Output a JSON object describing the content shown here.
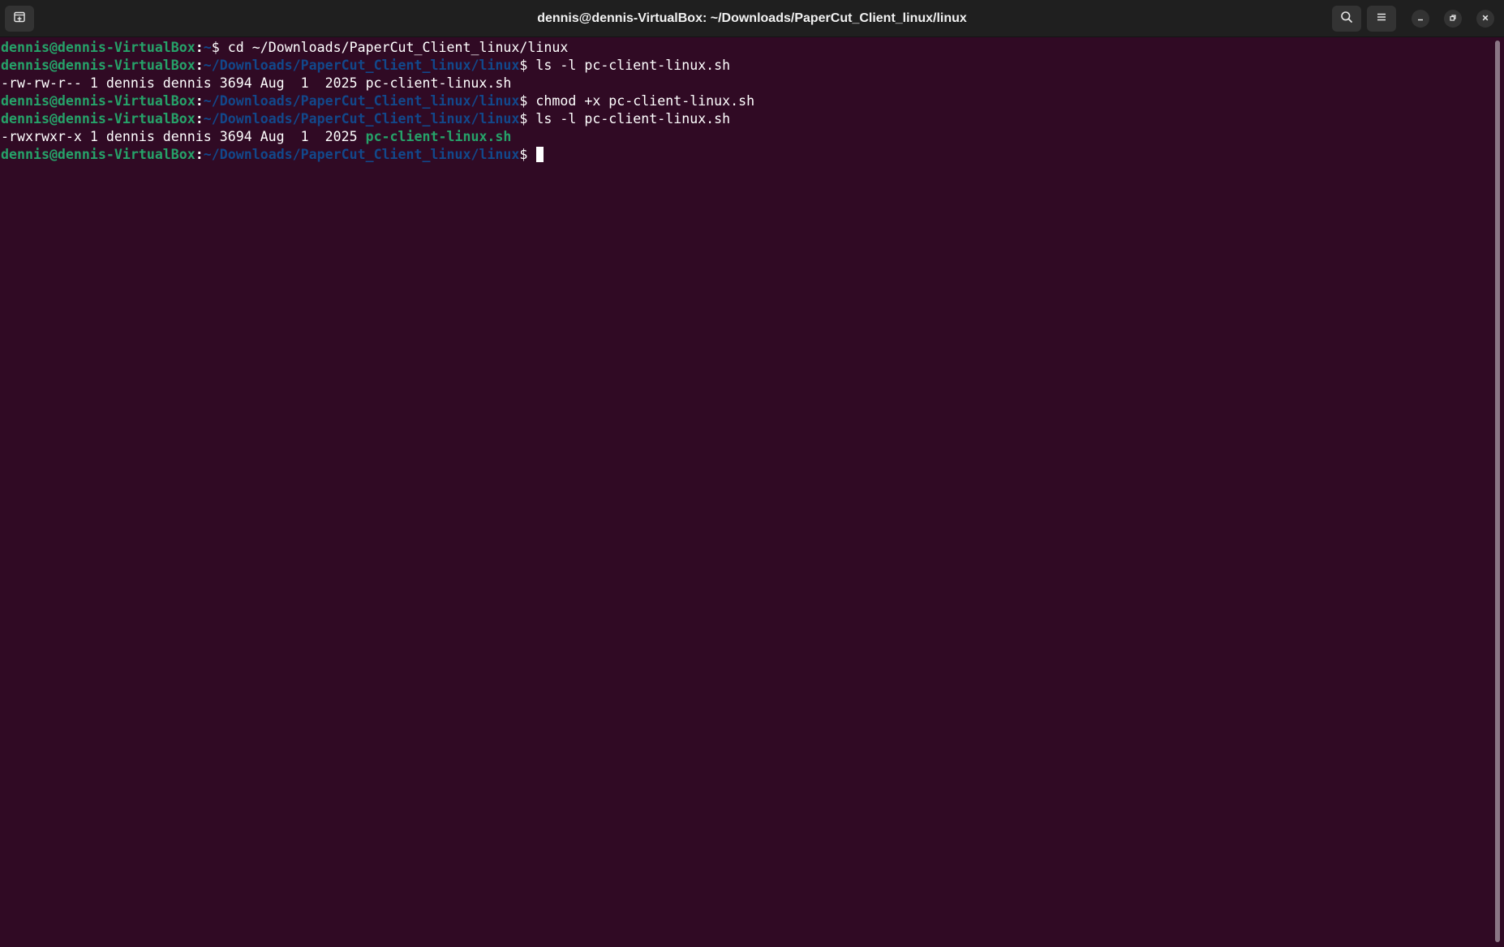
{
  "window": {
    "title": "dennis@dennis-VirtualBox: ~/Downloads/PaperCut_Client_linux/linux"
  },
  "titlebar": {
    "new_tab_icon": "new-tab-icon",
    "search_icon": "search-icon",
    "menu_icon": "hamburger-menu-icon",
    "minimize_icon": "minimize-icon",
    "maximize_icon": "restore-icon",
    "close_icon": "close-icon"
  },
  "colors": {
    "background": "#300a24",
    "prompt_user": "#26a269",
    "prompt_path": "#12488b",
    "executable": "#26a269",
    "text": "#ffffff"
  },
  "terminal": {
    "prompt_user": "dennis@dennis-VirtualBox",
    "prompt_colon": ":",
    "home_path": "~",
    "work_path": "~/Downloads/PaperCut_Client_linux/linux",
    "prompt_symbol": "$ ",
    "commands": [
      "cd ~/Downloads/PaperCut_Client_linux/linux",
      "ls -l pc-client-linux.sh",
      "chmod +x pc-client-linux.sh",
      "ls -l pc-client-linux.sh"
    ],
    "outputs": {
      "ls1": "-rw-rw-r-- 1 dennis dennis 3694 Aug  1  2025 pc-client-linux.sh",
      "ls2_prefix": "-rwxrwxr-x 1 dennis dennis 3694 Aug  1  2025 ",
      "ls2_file": "pc-client-linux.sh"
    }
  }
}
